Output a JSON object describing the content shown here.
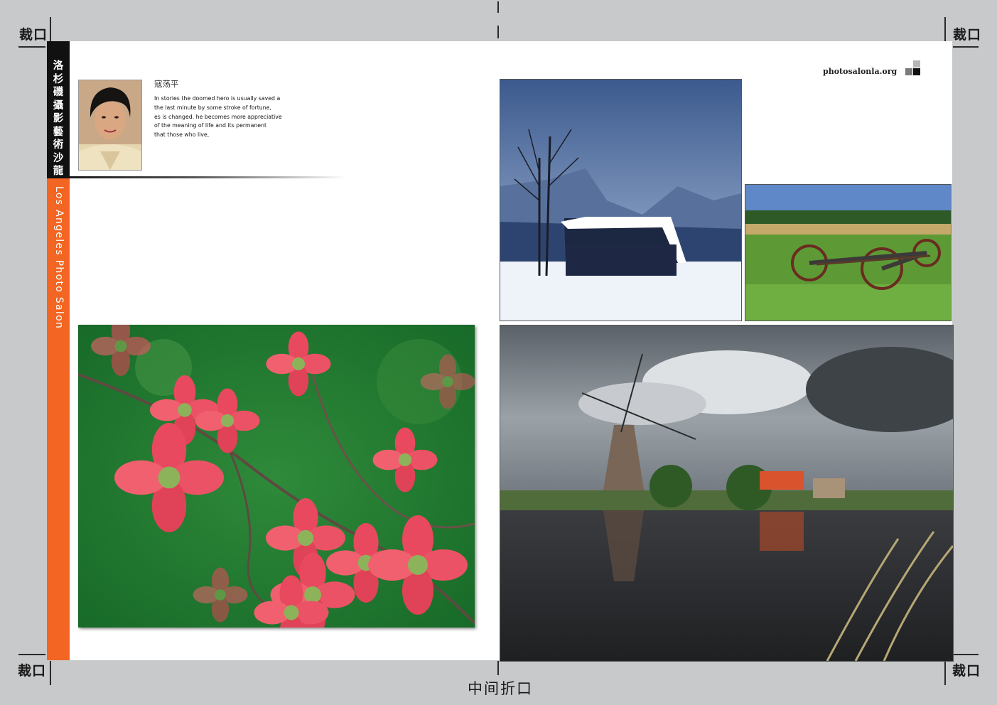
{
  "page": {
    "crop_mark_label": "裁口",
    "fold_label": "中间折口",
    "background": "#c8c9cb",
    "accent": "#f26522"
  },
  "sidebar": {
    "cn_title": "洛杉磯攝影藝術沙龍",
    "en_title": "Los Angeles Photo Salon"
  },
  "author": {
    "name": "寇荡平",
    "bio_lines": [
      "In stories the doomed hero is usually saved a",
      "the last minute by some stroke of fortune,",
      "es is changed. he becomes more appreciative",
      "of the meaning of life and its permanent",
      "that those who live,"
    ]
  },
  "brand": {
    "site": "photosalonla.org"
  },
  "photos": [
    {
      "subject": "red dogwood flowers"
    },
    {
      "subject": "snowy barn in winter"
    },
    {
      "subject": "old wagon wheels in a meadow"
    },
    {
      "subject": "windmill reflected in canal"
    }
  ]
}
